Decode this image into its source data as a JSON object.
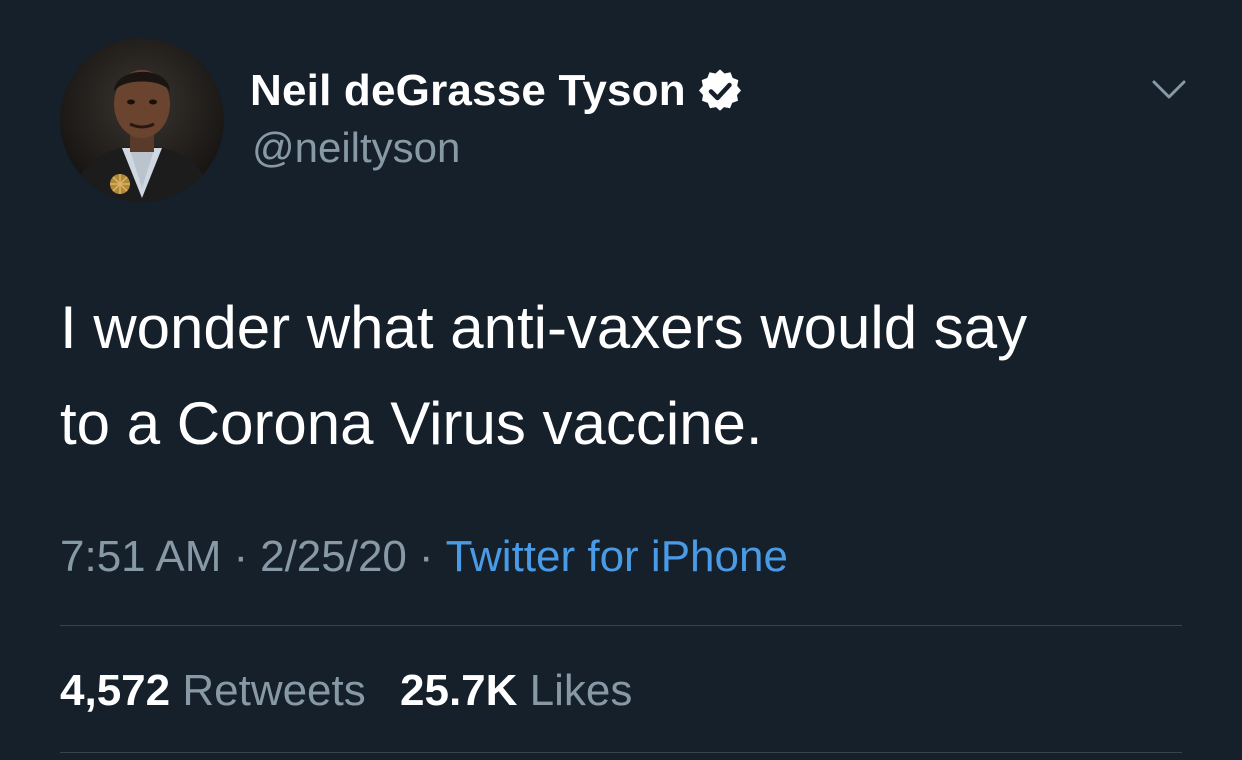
{
  "tweet": {
    "author": {
      "display_name": "Neil deGrasse Tyson",
      "handle": "@neiltyson",
      "verified": true,
      "avatar_icon": "user-avatar-photo"
    },
    "more_icon": "chevron-down-icon",
    "text_lines": [
      "I wonder what anti-vaxers would say",
      "to a Corona Virus vaccine."
    ],
    "time": "7:51 AM",
    "separator": "·",
    "date": "2/25/20",
    "source": "Twitter for iPhone",
    "stats": {
      "retweets_count": "4,572",
      "retweets_label": "Retweets",
      "likes_count": "25.7K",
      "likes_label": "Likes"
    }
  },
  "colors": {
    "background": "#15202b",
    "primary_text": "#ffffff",
    "secondary_text": "#8899a6",
    "link": "#4a9be6",
    "divider": "#38444d"
  }
}
